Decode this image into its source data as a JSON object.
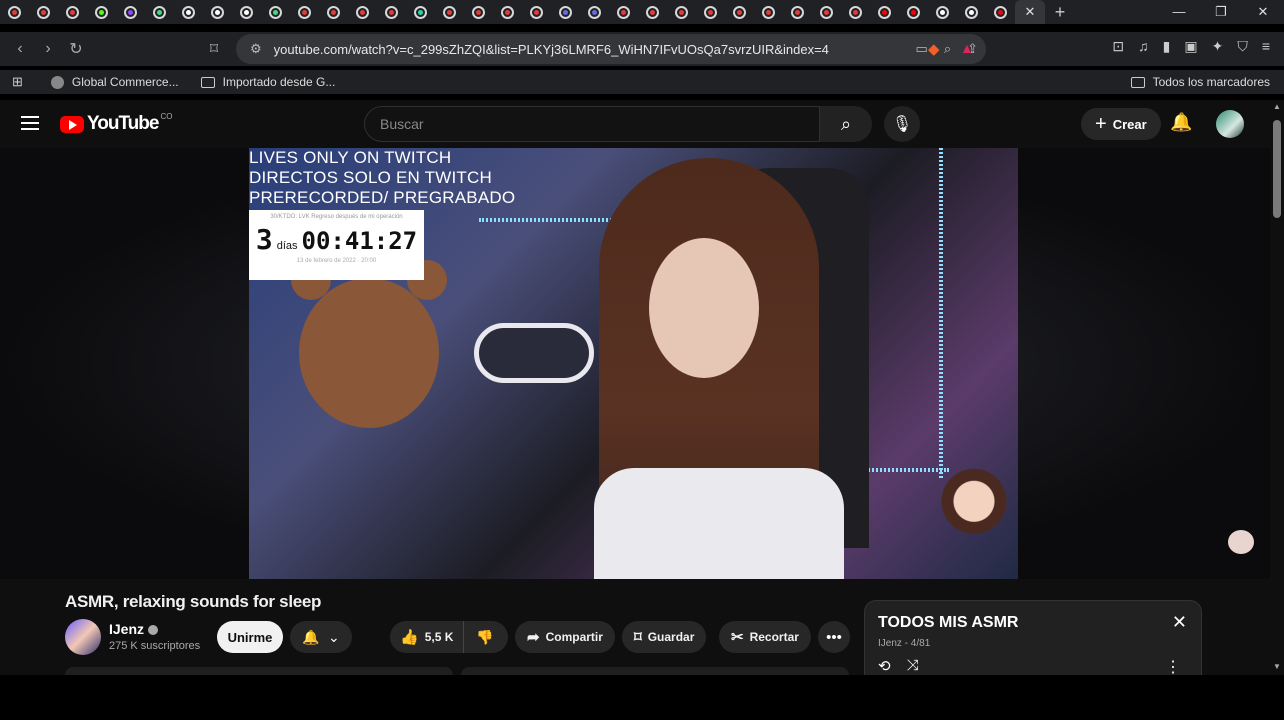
{
  "browser": {
    "tab_favicons": [
      {
        "color": "#e23b3b"
      },
      {
        "color": "#e23b3b"
      },
      {
        "color": "#e23b3b"
      },
      {
        "color": "#53fc18"
      },
      {
        "color": "#9146ff"
      },
      {
        "color": "#3ddc84"
      },
      {
        "color": "#ffffff"
      },
      {
        "color": "#ffffff"
      },
      {
        "color": "#ffffff"
      },
      {
        "color": "#3ddc84"
      },
      {
        "color": "#e23b3b"
      },
      {
        "color": "#e23b3b"
      },
      {
        "color": "#e23b3b"
      },
      {
        "color": "#e23b3b"
      },
      {
        "color": "#2bd4a4"
      },
      {
        "color": "#e23b3b"
      },
      {
        "color": "#e23b3b"
      },
      {
        "color": "#e23b3b"
      },
      {
        "color": "#e23b3b"
      },
      {
        "color": "#6a6adf"
      },
      {
        "color": "#6a6adf"
      },
      {
        "color": "#e23b3b"
      },
      {
        "color": "#e23b3b"
      },
      {
        "color": "#e23b3b"
      },
      {
        "color": "#e23b3b"
      },
      {
        "color": "#e23b3b"
      },
      {
        "color": "#e23b3b"
      },
      {
        "color": "#e23b3b"
      },
      {
        "color": "#e23b3b"
      },
      {
        "color": "#e23b3b"
      },
      {
        "color": "#ff0000"
      },
      {
        "color": "#ff0000"
      },
      {
        "color": "#ffffff"
      },
      {
        "color": "#ffffff"
      },
      {
        "color": "#e50914"
      }
    ],
    "active_tab_close": "✕",
    "new_tab": "+",
    "url": "youtube.com/watch?v=c_299sZhZQI&list=PLKYj36LMRF6_WiHN7IFvUOsQa7svrzUIR&index=4",
    "bookmarks": [
      {
        "label": "Global Commerce...",
        "icon": "globe-icon"
      },
      {
        "label": "Importado desde G...",
        "icon": "folder-icon"
      }
    ],
    "all_bookmarks": "Todos los marcadores"
  },
  "youtube": {
    "logo_text": "YouTube",
    "logo_country": "CO",
    "search_placeholder": "Buscar",
    "create_label": "Crear",
    "video": {
      "overlay_lines": [
        "LIVES ONLY ON TWITCH",
        "DIRECTOS SOLO EN TWITCH",
        "PRERECORDED/ PREGRABADO"
      ],
      "countdown_caption": "30/KTDO: LVK Regreso después de mi operación",
      "countdown_days": "3",
      "countdown_days_unit": "días",
      "countdown_time": "00:41:27",
      "countdown_date": "13 de febrero de 2022 · 20:00"
    },
    "title": "ASMR, relaxing sounds for sleep",
    "channel": {
      "name": "IJenz",
      "subscribers": "275 K suscriptores"
    },
    "join_label": "Unirme",
    "likes": "5,5 K",
    "share_label": "Compartir",
    "save_label": "Guardar",
    "clip_label": "Recortar",
    "playlist": {
      "title": "TODOS MIS ASMR",
      "subtitle": "IJenz - 4/81"
    }
  }
}
